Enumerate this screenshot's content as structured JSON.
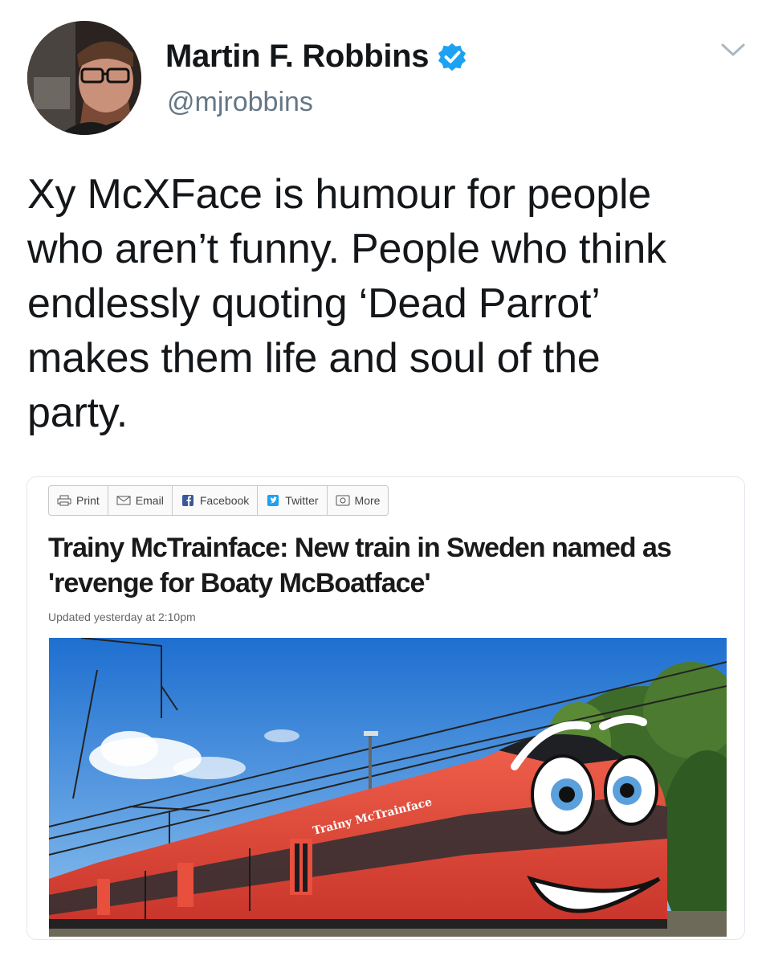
{
  "tweet": {
    "author_name": "Martin F. Robbins",
    "handle": "@mjrobbins",
    "text": "Xy McXFace is humour for people\nwho aren’t funny. People who think\nendlessly quoting ‘Dead Parrot’\nmakes them life and soul of the\nparty."
  },
  "icons": {
    "verified": "verified-badge-icon",
    "menu": "chevron-down-icon"
  },
  "colors": {
    "verified_blue": "#1da1f2",
    "handle_gray": "#657786",
    "train_red": "#e84f3d"
  },
  "article": {
    "share_buttons": [
      {
        "label": "Print",
        "icon": "print-icon"
      },
      {
        "label": "Email",
        "icon": "email-icon"
      },
      {
        "label": "Facebook",
        "icon": "facebook-icon"
      },
      {
        "label": "Twitter",
        "icon": "twitter-icon"
      },
      {
        "label": "More",
        "icon": "more-icon"
      }
    ],
    "title": "Trainy McTrainface: New train in Sweden named as 'revenge for Boaty McBoatface'",
    "updated": "Updated yesterday at 2:10pm",
    "train_label": "Trainy McTrainface"
  }
}
